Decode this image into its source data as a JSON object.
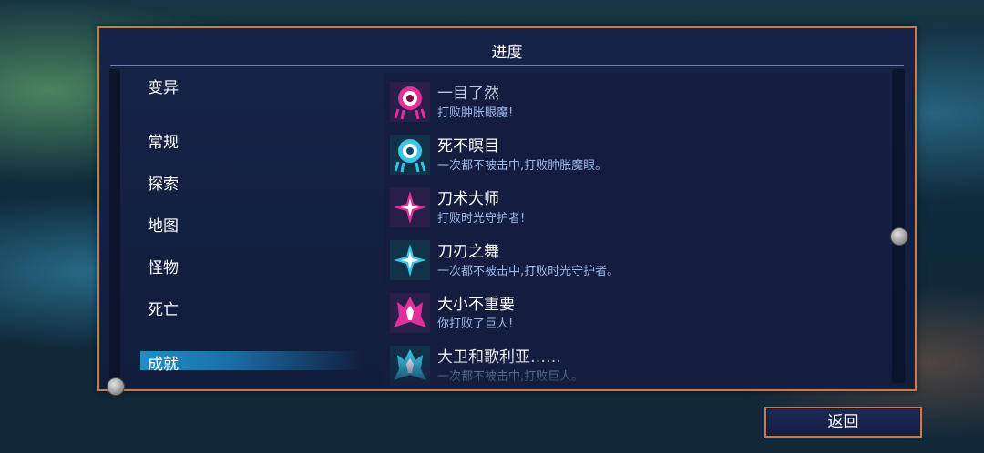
{
  "panel": {
    "title": "进度"
  },
  "categories": [
    {
      "label": "变异"
    },
    {
      "label": "常规"
    },
    {
      "label": "探索"
    },
    {
      "label": "地图"
    },
    {
      "label": "怪物"
    },
    {
      "label": "死亡"
    },
    {
      "label": "成就",
      "selected": true
    }
  ],
  "achievements": [
    {
      "title": "一目了然",
      "desc": "打败肿胀眼魔!",
      "icon": "eye-monster-icon",
      "color": "#e0309a"
    },
    {
      "title": "死不瞑目",
      "desc": "一次都不被击中,打败肿胀魔眼。",
      "icon": "eye-monster-icon",
      "color": "#39c6e6"
    },
    {
      "title": "刀术大师",
      "desc": "打败时光守护者!",
      "icon": "shuriken-icon",
      "color": "#e0309a"
    },
    {
      "title": "刀刃之舞",
      "desc": "一次都不被击中,打败时光守护者。",
      "icon": "shuriken-icon",
      "color": "#39c6e6"
    },
    {
      "title": "大小不重要",
      "desc": "你打败了巨人!",
      "icon": "giant-icon",
      "color": "#e0309a"
    },
    {
      "title": "大卫和歌利亚……",
      "desc": "一次都不被击中,打败巨人。",
      "icon": "giant-icon",
      "color": "#39c6e6"
    }
  ],
  "buttons": {
    "back": "返回"
  }
}
